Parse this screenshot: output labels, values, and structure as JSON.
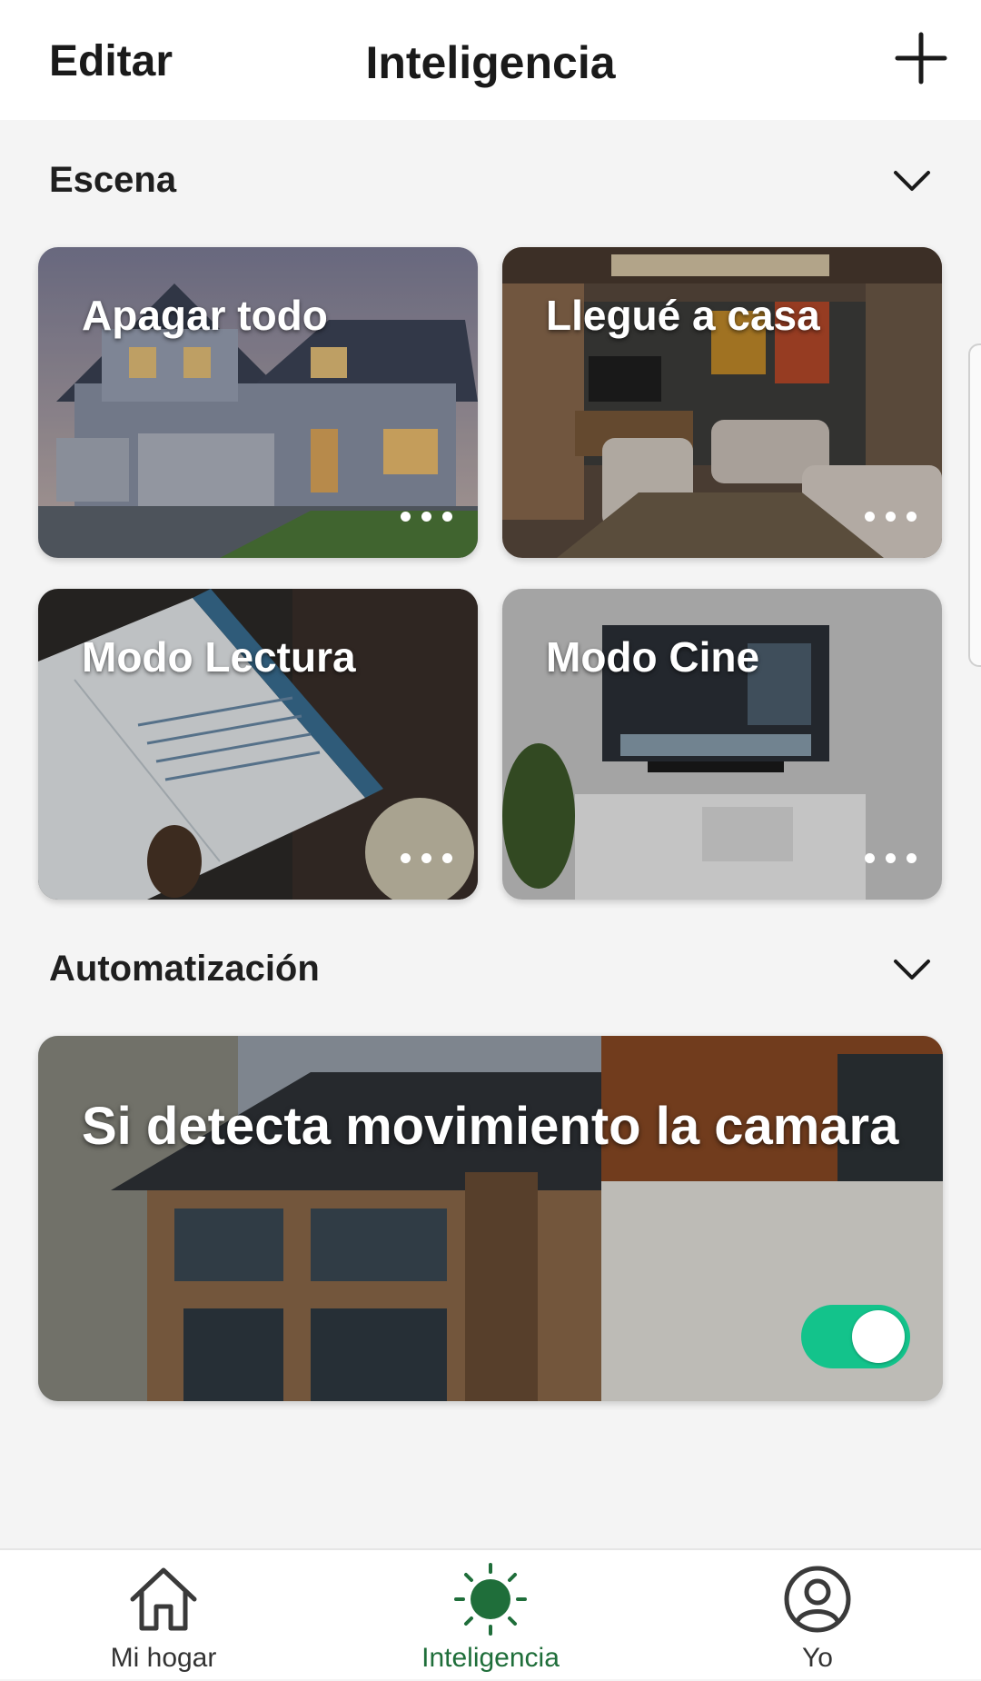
{
  "header": {
    "edit_label": "Editar",
    "title": "Inteligencia",
    "add_icon": "plus-icon"
  },
  "scenes": {
    "section_title": "Escena",
    "items": [
      {
        "label": "Apagar todo"
      },
      {
        "label": "Llegué a casa"
      },
      {
        "label": "Modo Lectura"
      },
      {
        "label": "Modo Cine"
      }
    ]
  },
  "automation": {
    "section_title": "Automatización",
    "items": [
      {
        "label": "Si detecta movimiento la camara",
        "enabled": true
      }
    ]
  },
  "bottom_nav": {
    "items": [
      {
        "label": "Mi hogar",
        "icon": "home-icon"
      },
      {
        "label": "Inteligencia",
        "icon": "sun-icon",
        "active": true
      },
      {
        "label": "Yo",
        "icon": "profile-icon"
      }
    ]
  },
  "colors": {
    "accent": "#13c38b",
    "active_nav": "#1f6e3a"
  }
}
